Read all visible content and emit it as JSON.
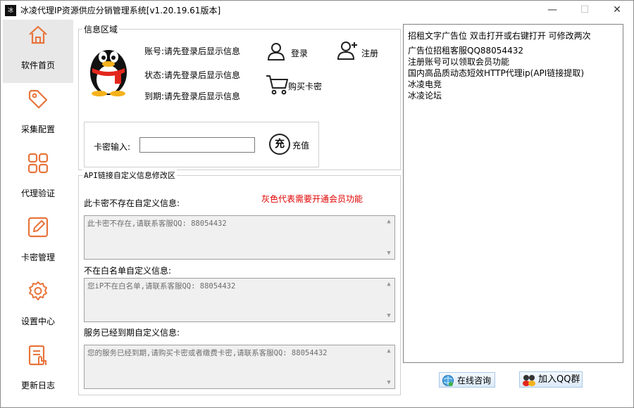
{
  "window": {
    "title": "冰凌代理IP资源供应分销管理系统[v1.20.19.61版本]",
    "icon_text": "冰"
  },
  "sidebar": {
    "items": [
      {
        "label": "软件首页",
        "icon": "home-icon"
      },
      {
        "label": "采集配置",
        "icon": "tag-icon"
      },
      {
        "label": "代理验证",
        "icon": "grid-icon"
      },
      {
        "label": "卡密管理",
        "icon": "edit-icon"
      },
      {
        "label": "设置中心",
        "icon": "gear-icon"
      },
      {
        "label": "更新日志",
        "icon": "log-icon"
      }
    ]
  },
  "info": {
    "title": "信息区域",
    "account": "账号:请先登录后显示信息",
    "status": "状态:请先登录后显示信息",
    "expire": "到期:请先登录后显示信息",
    "login": "登录",
    "register": "注册",
    "buy": "购买卡密",
    "card_label": "卡密输入:",
    "card_value": "",
    "recharge": "充值",
    "recharge_glyph": "充"
  },
  "api": {
    "title": "API链接自定义信息修改区",
    "notice": "灰色代表需要开通会员功能",
    "notice_color": "#e00000",
    "sections": [
      {
        "label": "此卡密不存在自定义信息:",
        "value": "此卡密不存在,请联系客服QQ: 88054432"
      },
      {
        "label": "不在白名单自定义信息:",
        "value": "您iP不在白名单,请联系客服QQ: 88054432"
      },
      {
        "label": "服务已经到期自定义信息:",
        "value": "您的服务已经到期,请购买卡密或者缴费卡密,请联系客服QQ: 88054432"
      }
    ]
  },
  "ads": {
    "lines": [
      "招租文字广告位 双击打开或右键打开 可修改两次",
      "广告位招租客服QQ88054432",
      "注册账号可以领取会员功能",
      "国内高品质动态短效HTTP代理ip(API链接提取)",
      "冰凌电竞",
      "冰凌论坛"
    ]
  },
  "footer": {
    "consult": "在线咨询",
    "join_qq": "加入QQ群"
  },
  "window_buttons": {
    "minimize": "—",
    "maximize": "☐",
    "close": "✕"
  }
}
